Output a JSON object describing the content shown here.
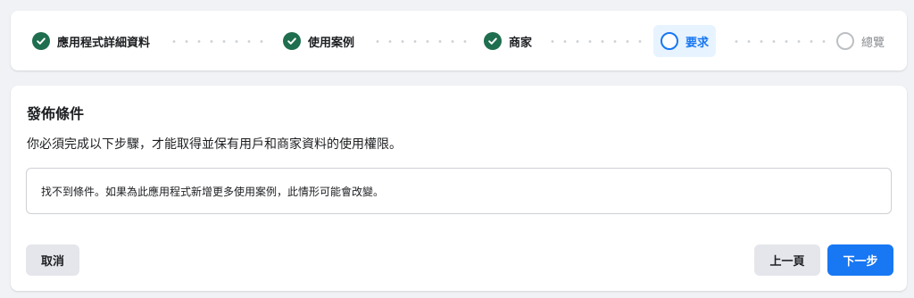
{
  "stepper": {
    "steps": [
      {
        "label": "應用程式詳細資料",
        "status": "done"
      },
      {
        "label": "使用案例",
        "status": "done"
      },
      {
        "label": "商家",
        "status": "done"
      },
      {
        "label": "要求",
        "status": "current"
      },
      {
        "label": "總覽",
        "status": "pending"
      }
    ]
  },
  "main": {
    "title": "發佈條件",
    "description": "你必須完成以下步驟，才能取得並保有用戶和商家資料的使用權限。",
    "notice": "找不到條件。如果為此應用程式新增更多使用案例，此情形可能會改變。"
  },
  "footer": {
    "cancel_label": "取消",
    "prev_label": "上一頁",
    "next_label": "下一步"
  },
  "colors": {
    "done_check": "#1f6e4f",
    "accent": "#1877f2",
    "current_bg": "#e7f3ff",
    "pending": "#bcc0c4"
  }
}
